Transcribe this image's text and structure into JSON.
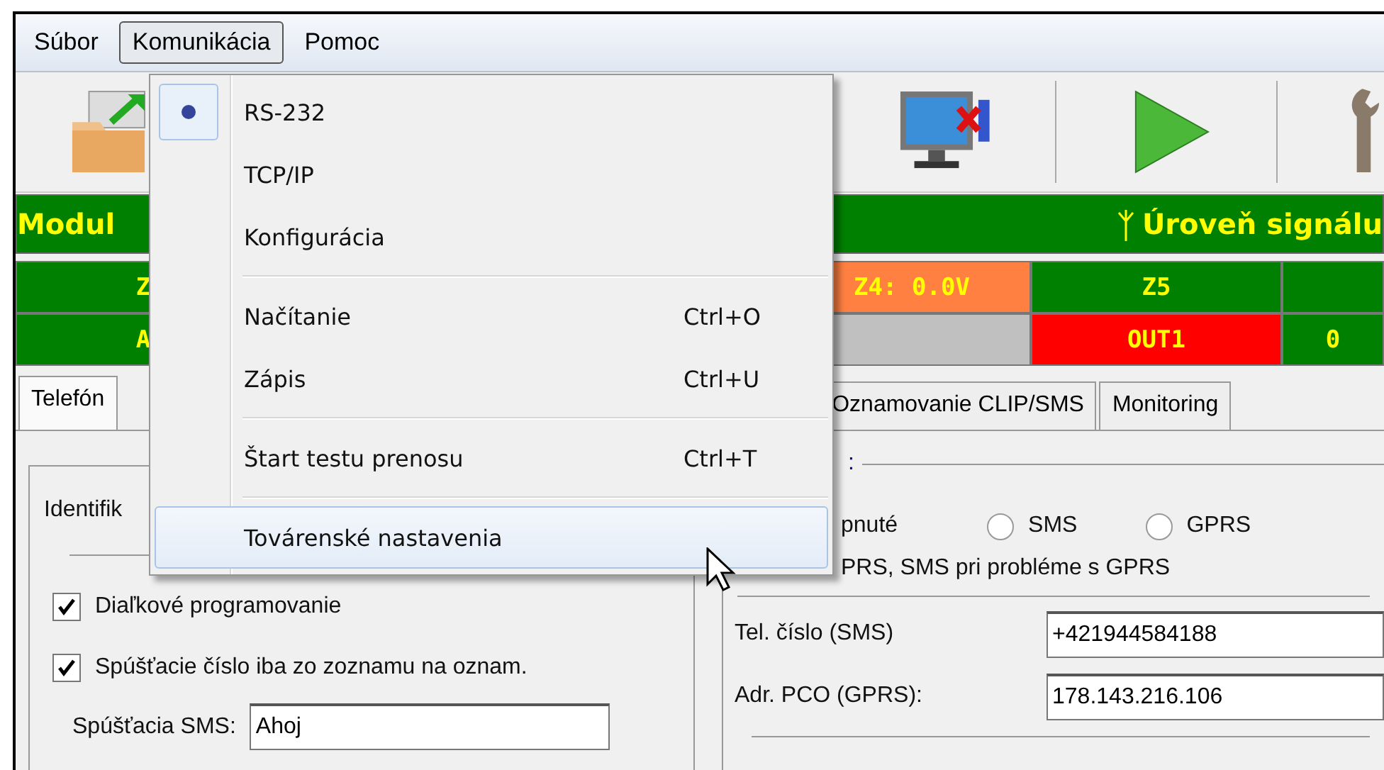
{
  "menu_bar": [
    {
      "label": "Súbor",
      "selected": false
    },
    {
      "label": "Komunikácia",
      "selected": true
    },
    {
      "label": "Pomoc",
      "selected": false
    }
  ],
  "signal_bar": {
    "module": "Modul",
    "signal": "Úroveň signálu"
  },
  "status_rows": [
    [
      {
        "text": "Z",
        "color": "#008000"
      },
      {
        "text": "Z4: 0.0V",
        "color": "#ff8040"
      },
      {
        "text": "Z5",
        "color": "#008000"
      },
      {
        "color": "#008000"
      }
    ],
    [
      {
        "text": "A",
        "color": "#008000"
      },
      {
        "color": "#c0c0c0"
      },
      {
        "text": "OUT1",
        "color": "#ff0000"
      },
      {
        "text": "0",
        "color": "#008000"
      }
    ]
  ],
  "tabs": [
    {
      "label": "Telefón",
      "selected": true
    },
    {
      "label": "Oznamovanie CLIP/SMS",
      "selected": false
    },
    {
      "label": "Monitoring",
      "selected": false
    }
  ],
  "left_panel": {
    "identification_label": "Identifik",
    "checkboxes": [
      {
        "label": "Diaľkové programovanie",
        "checked": true
      },
      {
        "label": "Spúšťacie číslo iba zo zoznamu na oznam.",
        "checked": true
      }
    ],
    "trigger_sms": {
      "label": "Spúšťacia SMS:",
      "value": "Ahoj"
    }
  },
  "right_panel": {
    "group_title": ":",
    "option_text": "pnuté",
    "radios": [
      {
        "label": "SMS",
        "selected": false
      },
      {
        "label": "GPRS",
        "selected": false
      }
    ],
    "option_text_2": "PRS, SMS pri probléme s GPRS",
    "fields": [
      {
        "label": "Tel. číslo (SMS)",
        "value": "+421944584188"
      },
      {
        "label": "Adr. PCO (GPRS):",
        "value": "178.143.216.106"
      }
    ]
  },
  "menu": [
    {
      "kind": "radio",
      "label": "RS-232",
      "selected": true,
      "hovered": false
    },
    {
      "kind": "radio",
      "label": "TCP/IP",
      "selected": false,
      "hovered": false
    },
    {
      "kind": "item",
      "label": "Konfigurácia",
      "hovered": false
    },
    {
      "kind": "separator"
    },
    {
      "kind": "item",
      "label": "Načítanie",
      "shortcut": "Ctrl+O",
      "hovered": false
    },
    {
      "kind": "item",
      "label": "Zápis",
      "shortcut": "Ctrl+U",
      "hovered": false
    },
    {
      "kind": "separator"
    },
    {
      "kind": "item",
      "label": "Štart testu prenosu",
      "shortcut": "Ctrl+T",
      "hovered": false
    },
    {
      "kind": "separator"
    },
    {
      "kind": "item",
      "label": "Továrenské nastavenia",
      "hovered": true
    }
  ]
}
